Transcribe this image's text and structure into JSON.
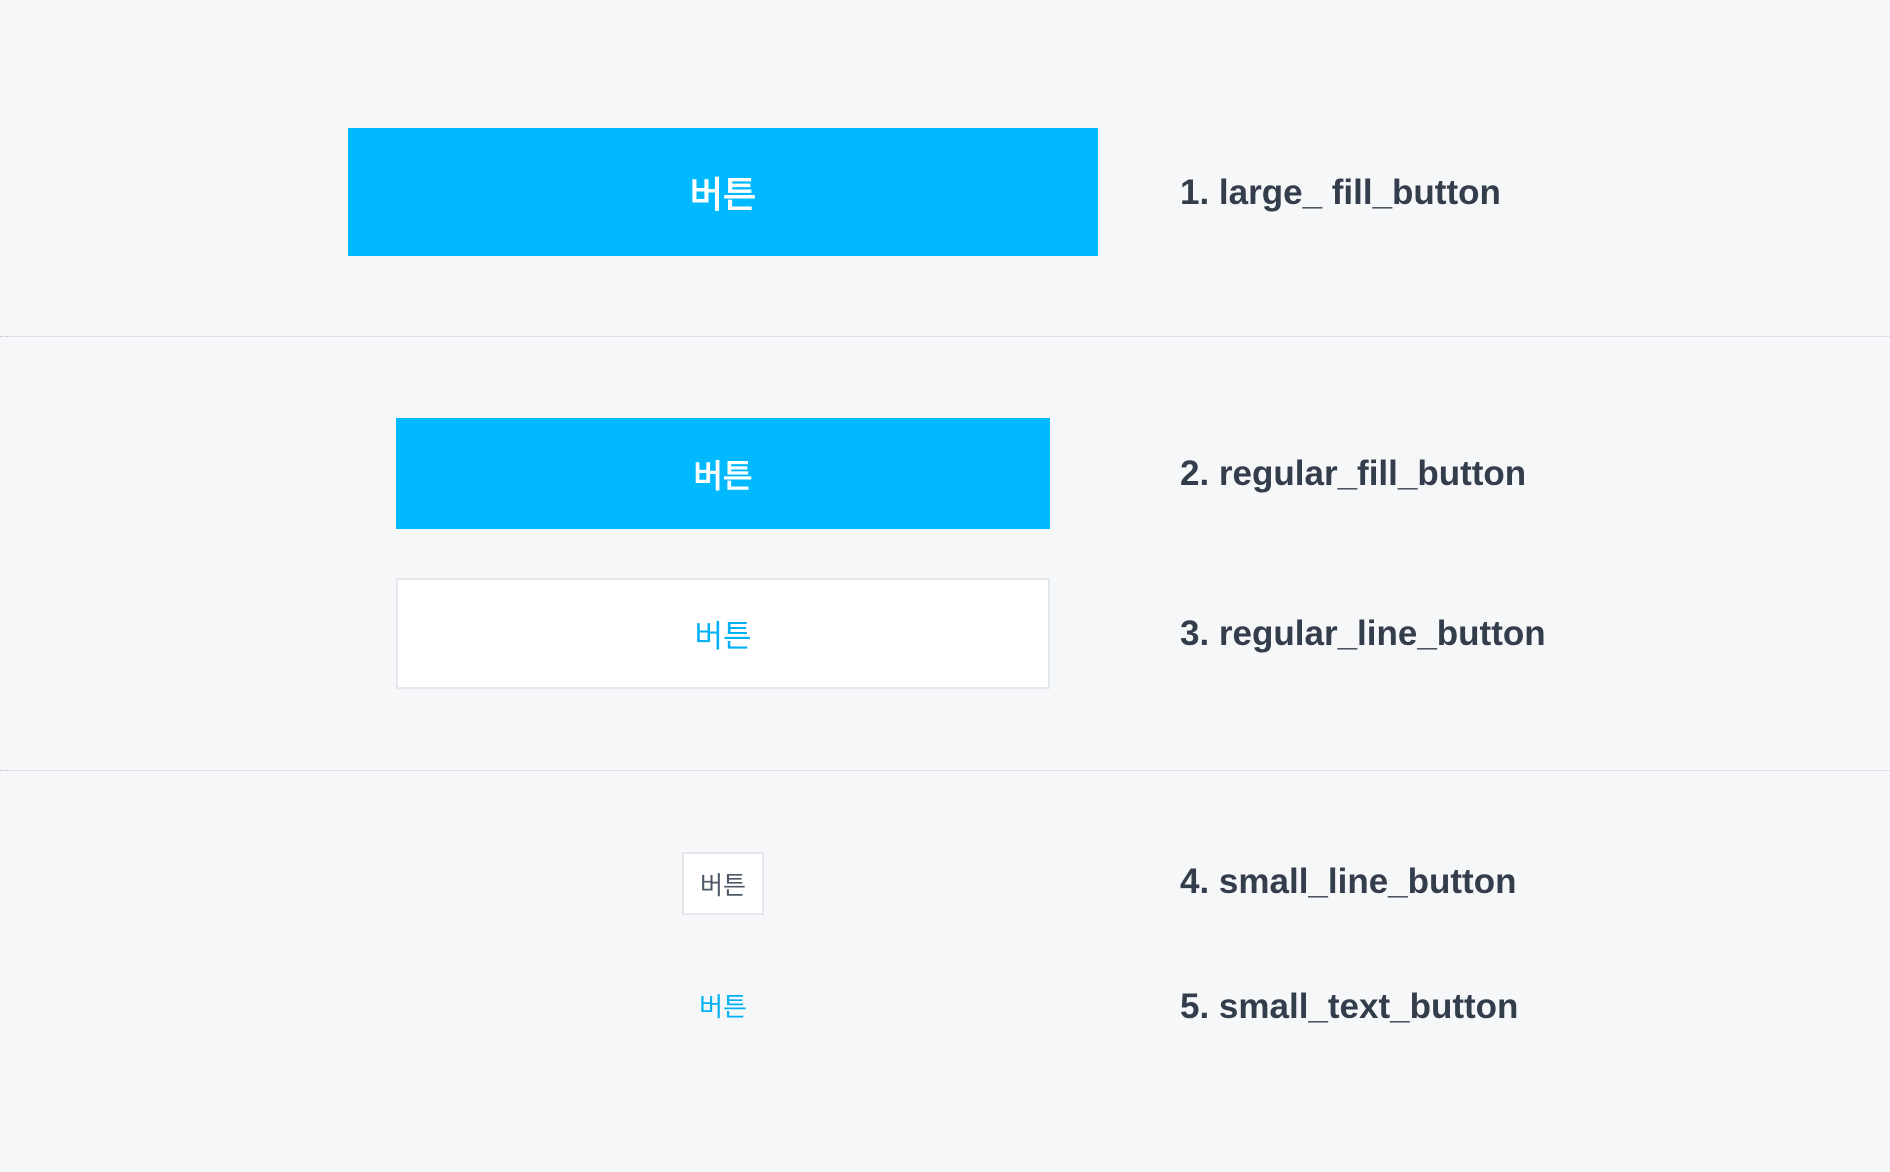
{
  "buttons": {
    "large_fill": {
      "label": "버튼"
    },
    "regular_fill": {
      "label": "버튼"
    },
    "regular_line": {
      "label": "버튼"
    },
    "small_line": {
      "label": "버튼"
    },
    "small_text": {
      "label": "버튼"
    }
  },
  "labels": [
    "1. large_ fill_button",
    "2. regular_fill_button",
    "3. regular_line_button",
    "4. small_line_button",
    "5. small_text_button"
  ],
  "colors": {
    "background": "#f6f7f9",
    "accent": "#00b9ff",
    "line_border": "#e4e7eb",
    "label_text": "#333d4b",
    "small_line_text": "#4e5968",
    "divider": "#c3c7cd"
  }
}
